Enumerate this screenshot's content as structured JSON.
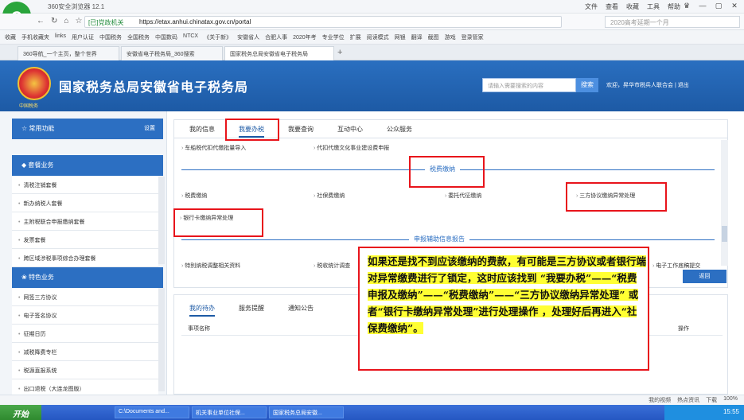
{
  "browser": {
    "title": "360安全浏览器 12.1",
    "menus": [
      "文件",
      "查看",
      "收藏",
      "工具",
      "帮助"
    ],
    "url_trust_label": "[已]党政机关",
    "url": "https://etax.anhui.chinatax.gov.cn/portal",
    "search_placeholder": "2020高考延期一个月",
    "favorites": [
      "收藏",
      "手机收藏夹",
      "links",
      "用户认证",
      "中国税务",
      "全国税务",
      "中国数码",
      "NTCX",
      "《关于新》",
      "安徽省人",
      "合肥人事",
      "2020年考",
      "专业学位",
      "扩展",
      "阅读模式",
      "网银",
      "翻译",
      "截图",
      "游戏",
      "登录管家"
    ],
    "tabs": [
      "360导航_一个主页，整个世界",
      "安徽省电子税务局_360搜索",
      "国家税务总局安徽省电子税务局"
    ],
    "status_items": [
      "我的视频",
      "热点资讯",
      "下载",
      "100%"
    ]
  },
  "site": {
    "emblem_caption": "中国税务",
    "title": "国家税务总局安徽省电子税务局",
    "search_placeholder": "请输入需要搜索的内容",
    "search_button": "搜索",
    "welcome": "欢迎，昇华市税兵人联合会 | 退出"
  },
  "sidebar": {
    "common_title": "常用功能",
    "common_setting": "设置",
    "package_title": "套餐业务",
    "package_items": [
      "清税注销套餐",
      "新办纳税人套餐",
      "主附税联合申报缴纳套餐",
      "发票套餐",
      "跨区域涉税事项综合办理套餐"
    ],
    "feature_title": "特色业务",
    "feature_items": [
      "网签三方协议",
      "电子签名协议",
      "征期日历",
      "减税降费专栏",
      "税源直报系统",
      "出口退税（大连龙图版）"
    ]
  },
  "main": {
    "tabs": [
      "我的信息",
      "我要办税",
      "我要查询",
      "互动中心",
      "公众服务"
    ],
    "top_links": [
      "车船税代扣代缴批量导入",
      "代扣代缴文化事业建设费申报"
    ],
    "section_title": "税费缴纳",
    "pay_links": [
      "税费缴纳",
      "社保费缴纳",
      "委托代征缴纳",
      "三方协议缴纳异常处理",
      "银行卡缴纳异常处理"
    ],
    "section2_title": "申报辅助信息报告",
    "cut_links": [
      "特别纳税调整相关资料",
      "税收统计调查",
      "电子工作底稿提交"
    ],
    "return_label": "返回"
  },
  "todo": {
    "tabs": [
      "我的待办",
      "服务提醒",
      "通知公告"
    ],
    "col_name": "事项名称",
    "col_action": "操作"
  },
  "annotation": {
    "text": "如果还是找不到应该缴纳的费款，有可能是三方协议或者银行端对异常缴费进行了锁定，这时应该找到 “我要办税”——“税费申报及缴纳”——“税费缴纳”——“三方协议缴纳异常处理” 或者“银行卡缴纳异常处理”进行处理操作 ，处理好后再进入“社保费缴纳”。"
  },
  "taskbar": {
    "start": "开始",
    "items": [
      "C:\\Documents and...",
      "机关事业单位社保...",
      "国家税务总局安徽..."
    ],
    "time": "15:55"
  }
}
